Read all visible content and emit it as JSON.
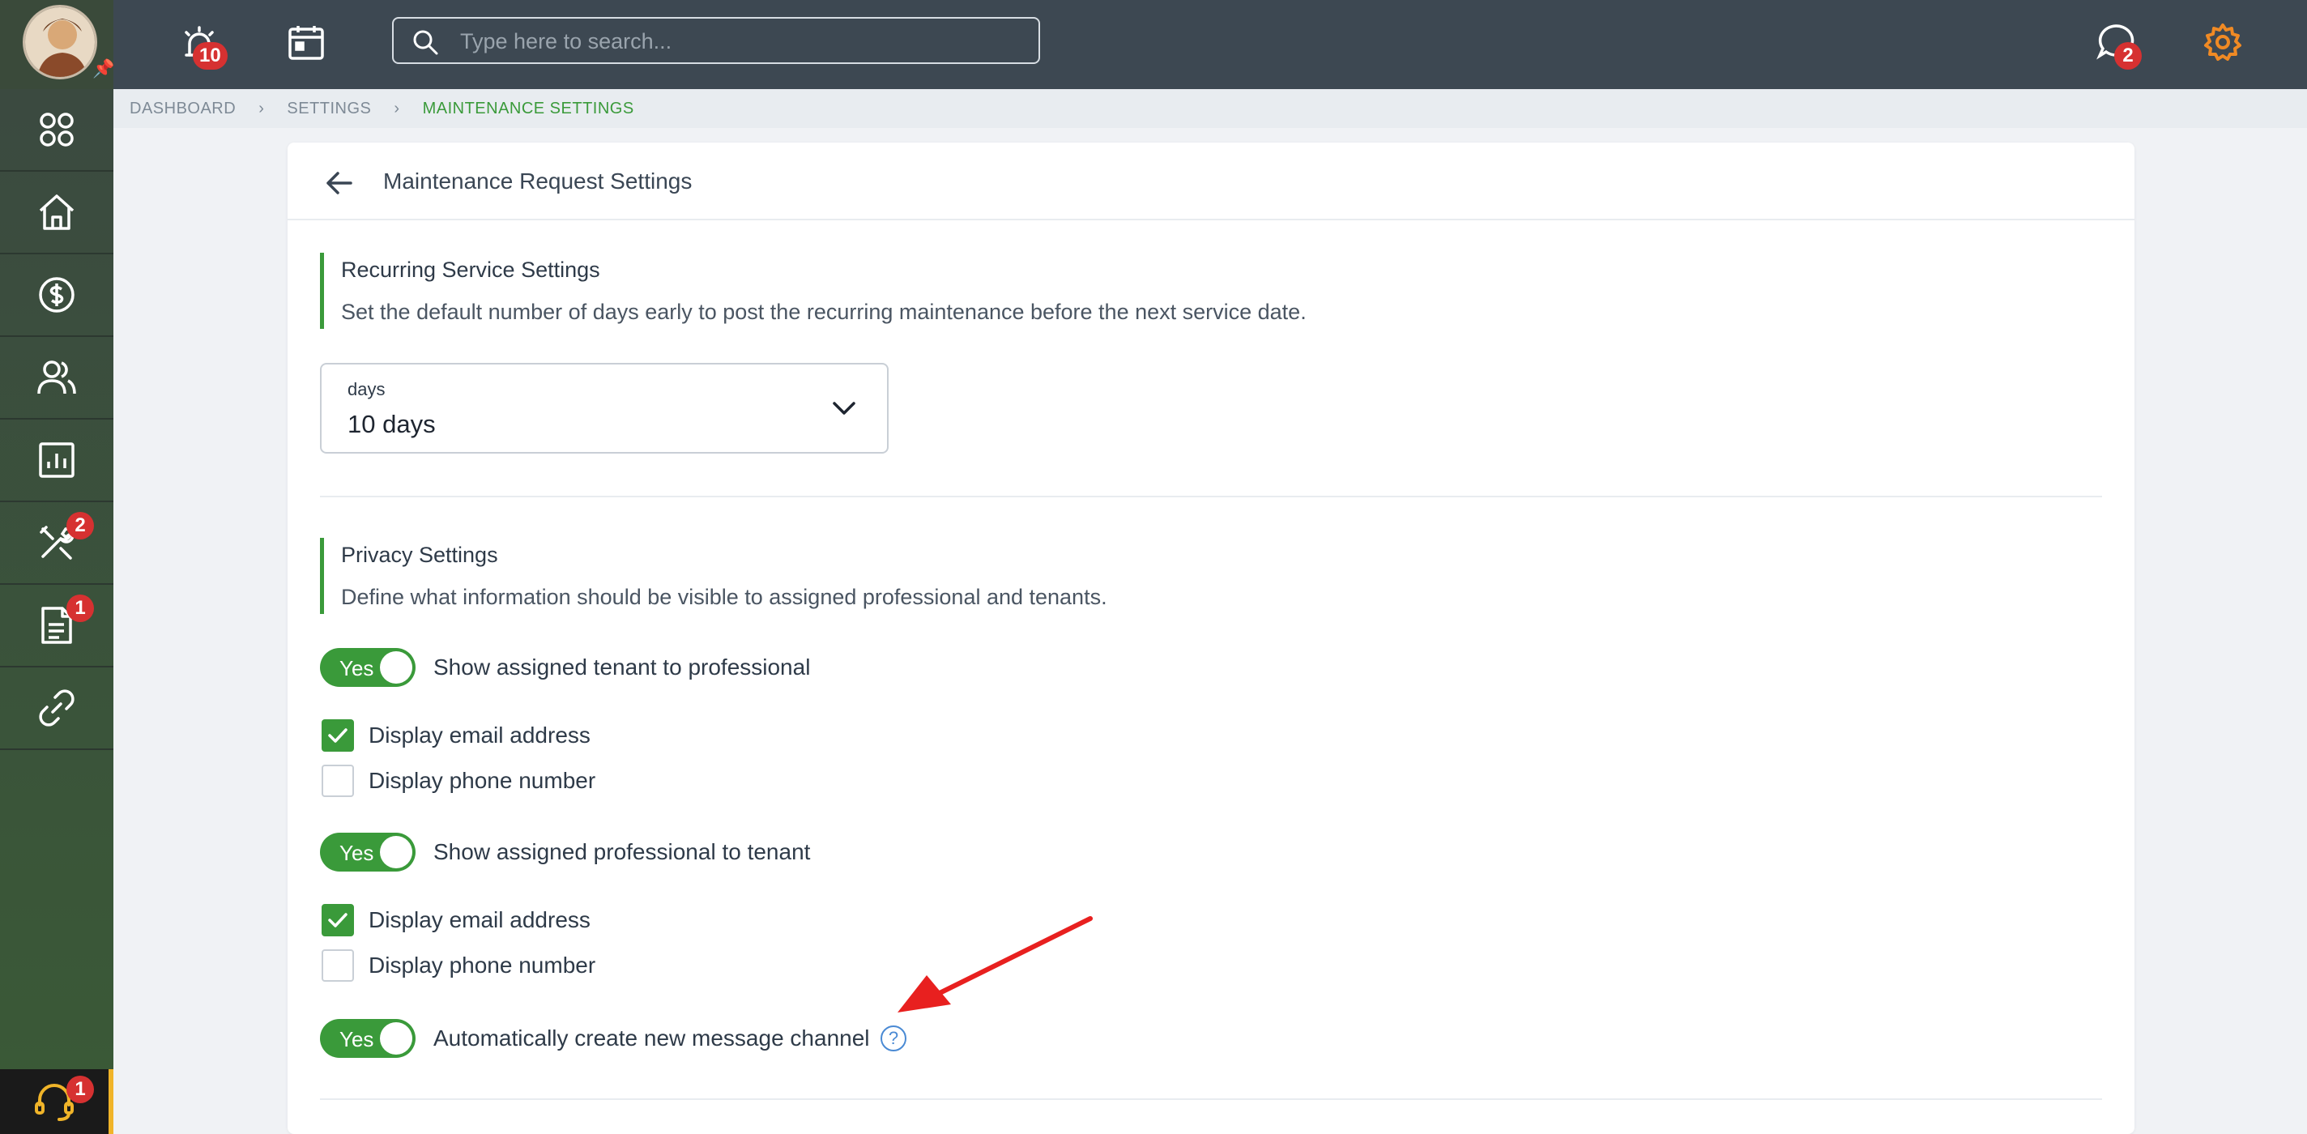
{
  "topbar": {
    "alarm_badge": "10",
    "search_placeholder": "Type here to search...",
    "messages_badge": "2"
  },
  "sidebar": {
    "items": [
      {
        "icon": "apps-grid-icon",
        "badge": null
      },
      {
        "icon": "home-icon",
        "badge": null
      },
      {
        "icon": "dollar-icon",
        "badge": null
      },
      {
        "icon": "people-icon",
        "badge": null
      },
      {
        "icon": "reports-chart-icon",
        "badge": null
      },
      {
        "icon": "maintenance-tools-icon",
        "badge": "2"
      },
      {
        "icon": "document-icon",
        "badge": "1"
      },
      {
        "icon": "link-icon",
        "badge": null
      }
    ],
    "support_badge": "1"
  },
  "breadcrumb": {
    "items": [
      "DASHBOARD",
      "SETTINGS",
      "MAINTENANCE SETTINGS"
    ]
  },
  "card": {
    "title": "Maintenance Request Settings",
    "recurring": {
      "title": "Recurring Service Settings",
      "description": "Set the default number of days early to post the recurring maintenance before the next service date.",
      "select_label": "days",
      "select_value": "10 days"
    },
    "privacy": {
      "title": "Privacy Settings",
      "description": "Define what information should be visible to assigned professional and tenants.",
      "toggle_tenant": {
        "value": "Yes",
        "label": "Show assigned tenant to professional"
      },
      "tenant_email": {
        "label": "Display email address",
        "checked": true
      },
      "tenant_phone": {
        "label": "Display phone number",
        "checked": false
      },
      "toggle_professional": {
        "value": "Yes",
        "label": "Show assigned professional to tenant"
      },
      "pro_email": {
        "label": "Display email address",
        "checked": true
      },
      "pro_phone": {
        "label": "Display phone number",
        "checked": false
      },
      "toggle_channel": {
        "value": "Yes",
        "label": "Automatically create new message channel"
      },
      "help": "?"
    }
  },
  "colors": {
    "accent_green": "#3a9a3a",
    "badge_red": "#d63131",
    "topbar": "#3d4852",
    "gear_orange": "#f08a24"
  }
}
